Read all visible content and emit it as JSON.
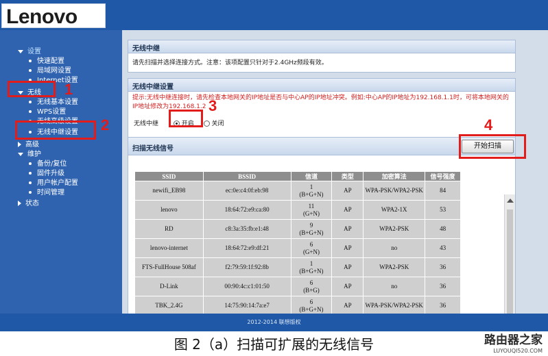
{
  "header": {
    "logo": "Lenovo"
  },
  "sidebar": {
    "sections": [
      {
        "label": "设置",
        "items": [
          "快速配置",
          "局域网设置",
          "Internet设置"
        ]
      },
      {
        "label": "无线",
        "items": [
          "无线基本设置",
          "WPS设置",
          "无线高级设置",
          "无线中继设置"
        ]
      },
      {
        "label": "高级",
        "items": []
      },
      {
        "label": "维护",
        "items": [
          "备份/复位",
          "固件升级",
          "用户帐户配置",
          "时间管理"
        ]
      },
      {
        "label": "状态",
        "items": []
      }
    ]
  },
  "panels": {
    "relay": {
      "title": "无线中继",
      "desc": "请先扫描并选择连接方式。注意：该项配置只针对于2.4GHz频段有效。"
    },
    "relay_settings": {
      "title": "无线中继设置",
      "warning": "提示:无线中继连接时，请先检查本地网关的IP地址是否与中心AP的IP地址冲突。例如:中心AP的IP地址为192.168.1.1时，可将本地网关的IP地址修改为192.168.1.2",
      "toggle_label": "无线中继",
      "on": "开启",
      "off": "关闭"
    },
    "scan": {
      "title": "扫描无线信号",
      "button": "开始扫描"
    }
  },
  "table": {
    "headers": [
      "SSID",
      "BSSID",
      "信道",
      "类型",
      "加密算法",
      "信号强度"
    ],
    "rows": [
      [
        "newifi_EB98",
        "ec:0e:c4:0f:eb:98",
        "1\n(B+G+N)",
        "AP",
        "WPA-PSK/WPA2-PSK",
        "84"
      ],
      [
        "lenovo",
        "18:64:72:e9:ca:80",
        "11\n(G+N)",
        "AP",
        "WPA2-1X",
        "53"
      ],
      [
        "RD",
        "c8:3a:35:fb:e1:48",
        "9\n(B+G+N)",
        "AP",
        "WPA2-PSK",
        "48"
      ],
      [
        "lenovo-internet",
        "18:64:72:e9:df:21",
        "6\n(G+N)",
        "AP",
        "no",
        "43"
      ],
      [
        "FTS-FullHouse 508af",
        "f2:79:59:1f:92:8b",
        "1\n(B+G+N)",
        "AP",
        "WPA2-PSK",
        "36"
      ],
      [
        "D-Link",
        "00:90:4c:c1:01:50",
        "6\n(B+G)",
        "AP",
        "no",
        "36"
      ],
      [
        "TBK_2.4G",
        "14:75:90:14:7a:e7",
        "6\n(B+G+N)",
        "AP",
        "WPA-PSK/WPA2-PSK",
        "36"
      ]
    ]
  },
  "annotations": [
    "1",
    "2",
    "3",
    "4"
  ],
  "footer": "2012-2014 联想版权",
  "caption": "图 2（a）扫描可扩展的无线信号",
  "watermark": {
    "cn": "路由器之家",
    "en": "LUYOUQI520.COM"
  },
  "colors": {
    "header": "#1f58a7",
    "sidebar": "#2f63b0",
    "highlight": "#e21b1b",
    "table_header": "#8e8e8e",
    "table_cell": "#cfcfcf"
  }
}
